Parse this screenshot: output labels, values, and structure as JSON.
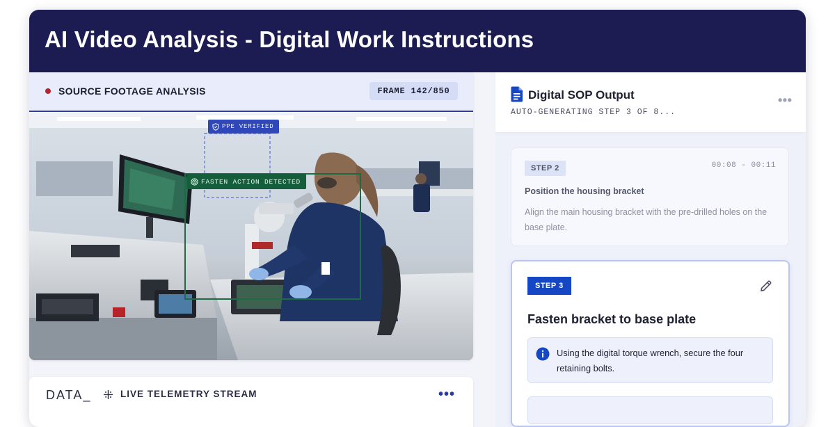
{
  "header": {
    "title": "AI Video Analysis - Digital Work Instructions"
  },
  "source_panel": {
    "label": "SOURCE FOOTAGE ANALYSIS",
    "frame_badge": "FRAME 142/850",
    "detections": [
      {
        "label": "PPE VERIFIED",
        "icon": "shield-icon"
      },
      {
        "label": "FASTEN ACTION DETECTED",
        "icon": "target-icon"
      }
    ]
  },
  "telemetry": {
    "logo": "DATA_",
    "label": "LIVE TELEMETRY STREAM",
    "more_label": "•••"
  },
  "sop": {
    "title": "Digital SOP Output",
    "subtitle": "AUTO-GENERATING STEP 3 OF 8...",
    "more_label": "•••",
    "step2": {
      "badge": "STEP 2",
      "time": "00:08 - 00:11",
      "title": "Position the housing bracket",
      "description": "Align the main housing bracket with the pre-drilled holes on the base plate."
    },
    "step3": {
      "badge": "STEP 3",
      "title": "Fasten bracket to base plate",
      "note": "Using the digital torque wrench, secure the four retaining bolts."
    }
  },
  "colors": {
    "header_bg": "#1c1c52",
    "accent_blue": "#1547c4",
    "ppe_tag": "#2f47b8",
    "action_tag": "#155e3c",
    "record_dot": "#b3262f"
  }
}
